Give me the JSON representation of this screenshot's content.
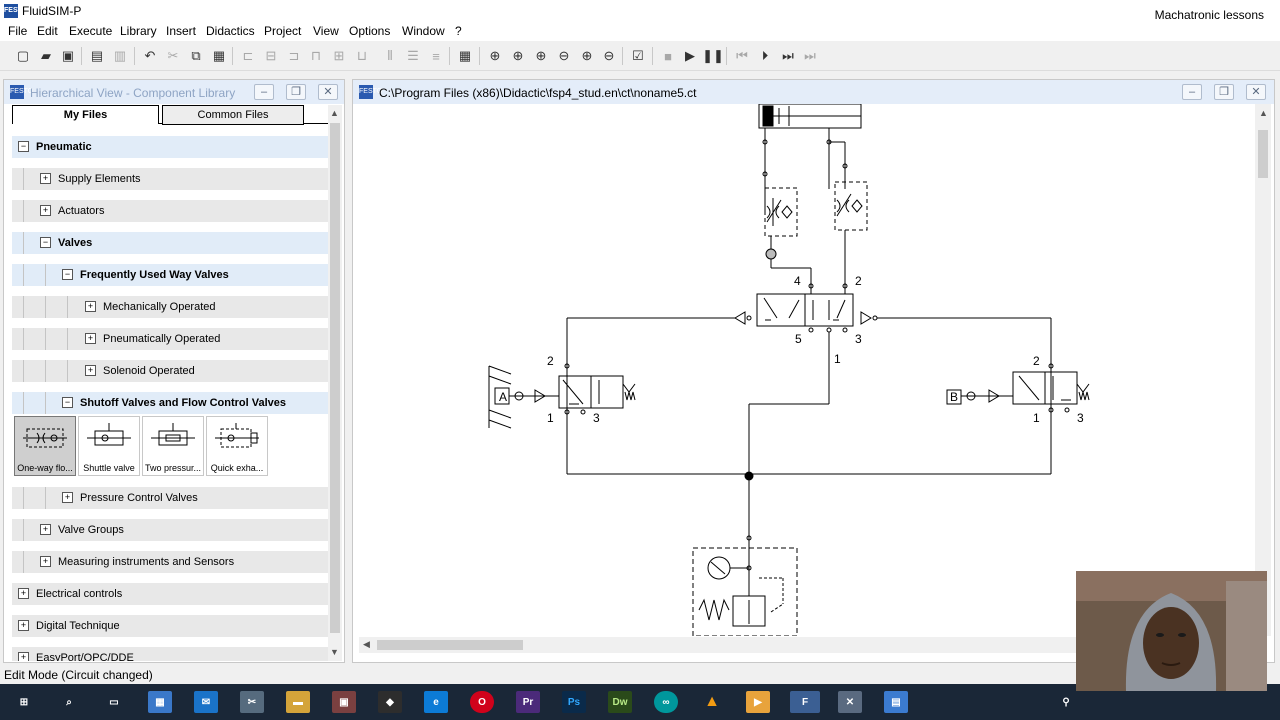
{
  "window": {
    "title": "FluidSIM-P",
    "icon_text": "FESTO",
    "channel": "Machatronic lessons"
  },
  "menu": [
    "File",
    "Edit",
    "Execute",
    "Library",
    "Insert",
    "Didactics",
    "Project",
    "View",
    "Options",
    "Window",
    "?"
  ],
  "toolbar_icons": [
    "new-file",
    "open-folder",
    "save",
    "print-preview",
    "print",
    "undo",
    "cut",
    "copy",
    "paste",
    "align-left",
    "align-center",
    "align-right",
    "align-top",
    "align-middle",
    "align-bottom",
    "distribute-h",
    "distribute-v",
    "grid",
    "zoom-1to1",
    "zoom-circuit",
    "zoom-window",
    "zoom-previous",
    "zoom-in",
    "zoom-out",
    "check-drawing",
    "stop",
    "play",
    "pause",
    "reset",
    "step-back",
    "step",
    "step-forward"
  ],
  "library_panel": {
    "title": "Hierarchical View - Component Library",
    "tabs": [
      "My Files",
      "Common Files"
    ],
    "tree": [
      {
        "label": "Pneumatic",
        "level": 0,
        "expanded": true,
        "bold": true
      },
      {
        "label": "Supply Elements",
        "level": 1,
        "expanded": false,
        "bold": false
      },
      {
        "label": "Actuators",
        "level": 1,
        "expanded": false,
        "bold": false
      },
      {
        "label": "Valves",
        "level": 1,
        "expanded": true,
        "bold": true
      },
      {
        "label": "Frequently Used Way Valves",
        "level": 2,
        "expanded": true,
        "bold": true
      },
      {
        "label": "Mechanically Operated",
        "level": 3,
        "expanded": false,
        "bold": false
      },
      {
        "label": "Pneumatically Operated",
        "level": 3,
        "expanded": false,
        "bold": false
      },
      {
        "label": "Solenoid Operated",
        "level": 3,
        "expanded": false,
        "bold": false
      },
      {
        "label": "Shutoff Valves and Flow Control Valves",
        "level": 2,
        "expanded": true,
        "bold": true
      }
    ],
    "components": [
      {
        "label": "One-way flo...",
        "selected": true
      },
      {
        "label": "Shuttle valve",
        "selected": false
      },
      {
        "label": "Two pressur...",
        "selected": false
      },
      {
        "label": "Quick exha...",
        "selected": false
      }
    ],
    "tree_after": [
      {
        "label": "Pressure Control Valves",
        "level": 2,
        "expanded": false
      },
      {
        "label": "Valve Groups",
        "level": 1,
        "expanded": false
      },
      {
        "label": "Measuring instruments and Sensors",
        "level": 1,
        "expanded": false
      },
      {
        "label": "Electrical controls",
        "level": 0,
        "expanded": false
      },
      {
        "label": "Digital Technique",
        "level": 0,
        "expanded": false
      },
      {
        "label": "EasyPort/OPC/DDE",
        "level": 0,
        "expanded": false
      }
    ]
  },
  "circuit_window": {
    "title": "C:\\Program Files (x86)\\Didactic\\fsp4_stud.en\\ct\\noname5.ct",
    "labels": {
      "port_4": "4",
      "port_2_main": "2",
      "port_5": "5",
      "port_3_main": "3",
      "port_1_main": "1",
      "left_2": "2",
      "left_1": "1",
      "left_3": "3",
      "left_A": "A",
      "right_2": "2",
      "right_1": "1",
      "right_3": "3",
      "right_B": "B"
    }
  },
  "status": "Edit Mode (Circuit changed)",
  "taskbar": [
    "start",
    "search",
    "task-view",
    "store",
    "mail",
    "snipping",
    "explorer",
    "app-dark",
    "app-diamond",
    "edge",
    "opera",
    "premiere",
    "photoshop",
    "dreamweaver",
    "arduino",
    "vlc",
    "media",
    "fluidsim",
    "app-x",
    "app-calc"
  ],
  "colors": {
    "panel_title_bg": "#e4edf9",
    "tree_selected": "#e1ecf8",
    "taskbar": "#1a2737"
  }
}
